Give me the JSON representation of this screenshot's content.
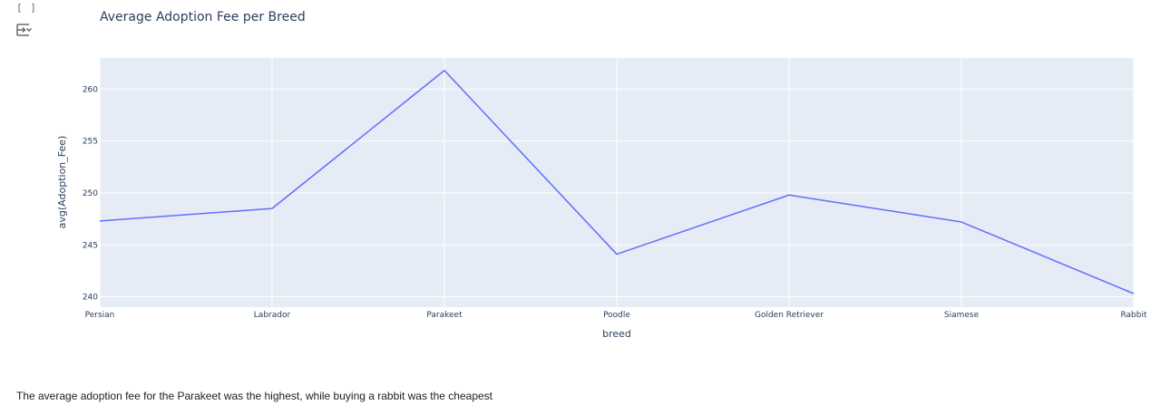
{
  "cell": {
    "brackets": "[ ]",
    "output_icon": "output-toggle-icon"
  },
  "chart_data": {
    "type": "line",
    "title": "Average Adoption Fee per Breed",
    "xlabel": "breed",
    "ylabel": "avg(Adoption_Fee)",
    "categories": [
      "Persian",
      "Labrador",
      "Parakeet",
      "Poodle",
      "Golden Retriever",
      "Siamese",
      "Rabbit"
    ],
    "values": [
      247.3,
      248.5,
      261.8,
      244.1,
      249.8,
      247.2,
      240.3
    ],
    "ylim": [
      239,
      263
    ],
    "yticks": [
      240,
      245,
      250,
      255,
      260
    ],
    "grid": true,
    "line_color": "#636efa",
    "plot_bg": "#e5ecf6",
    "grid_color": "#ffffff"
  },
  "caption": {
    "text": "The average adoption fee for the Parakeet was the highest, while buying a rabbit was the cheapest"
  }
}
